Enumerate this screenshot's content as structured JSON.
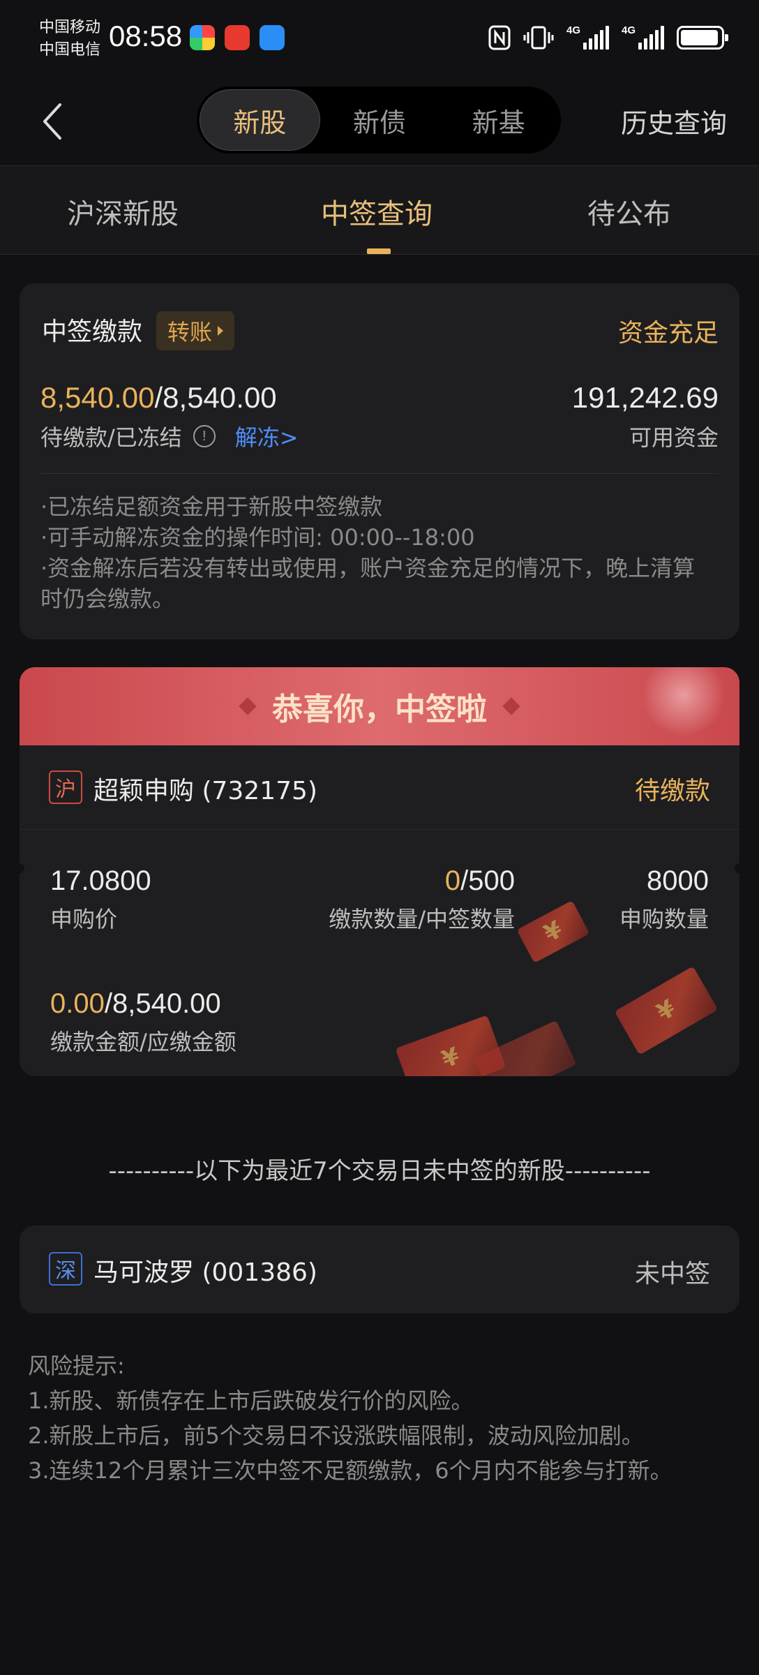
{
  "status_bar": {
    "carrier_1": "中国移动",
    "carrier_2": "中国电信",
    "time": "08:58",
    "network_1": "4G",
    "network_2": "4G"
  },
  "nav": {
    "segments": [
      "新股",
      "新债",
      "新基"
    ],
    "active_segment": "新股",
    "history_label": "历史查询"
  },
  "subtabs": {
    "items": [
      "沪深新股",
      "中签查询",
      "待公布"
    ],
    "active": "中签查询"
  },
  "payment_card": {
    "title": "中签缴款",
    "transfer_label": "转账",
    "fund_status": "资金充足",
    "pending_amount": "8,540.00",
    "frozen_amount": "/8,540.00",
    "amount_label": "待缴款/已冻结",
    "unfreeze_label": "解冻>",
    "available_funds": "191,242.69",
    "available_label": "可用资金",
    "notes": [
      "·已冻结足额资金用于新股中签缴款",
      "·可手动解冻资金的操作时间: 00:00--18:00",
      "·资金解冻后若没有转出或使用，账户资金充足的情况下，晚上清算时仍会缴款。"
    ]
  },
  "win_card": {
    "banner_text": "恭喜你，中签啦",
    "market_tag": "沪",
    "stock_name": "超颖申购 (732175)",
    "status": "待缴款",
    "price": "17.0800",
    "price_label": "申购价",
    "paid_qty": "0",
    "won_qty": "/500",
    "qty_label": "缴款数量/中签数量",
    "applied_qty": "8000",
    "applied_label": "申购数量",
    "paid_amount": "0.00",
    "due_amount": "/8,540.00",
    "amount_label": "缴款金额/应缴金额"
  },
  "separator": "----------以下为最近7个交易日未中签的新股----------",
  "lost_card": {
    "market_tag": "深",
    "stock_name": "马可波罗 (001386)",
    "status": "未中签"
  },
  "risk": {
    "title": "风险提示:",
    "items": [
      "1.新股、新债存在上市后跌破发行价的风险。",
      "2.新股上市后，前5个交易日不设涨跌幅限制，波动风险加剧。",
      "3.连续12个月累计三次中签不足额缴款，6个月内不能参与打新。"
    ]
  },
  "colors": {
    "accent_gold": "#e9b35a",
    "link_blue": "#4f8ef7",
    "banner_red": "#d35a5e",
    "background": "#111113"
  }
}
